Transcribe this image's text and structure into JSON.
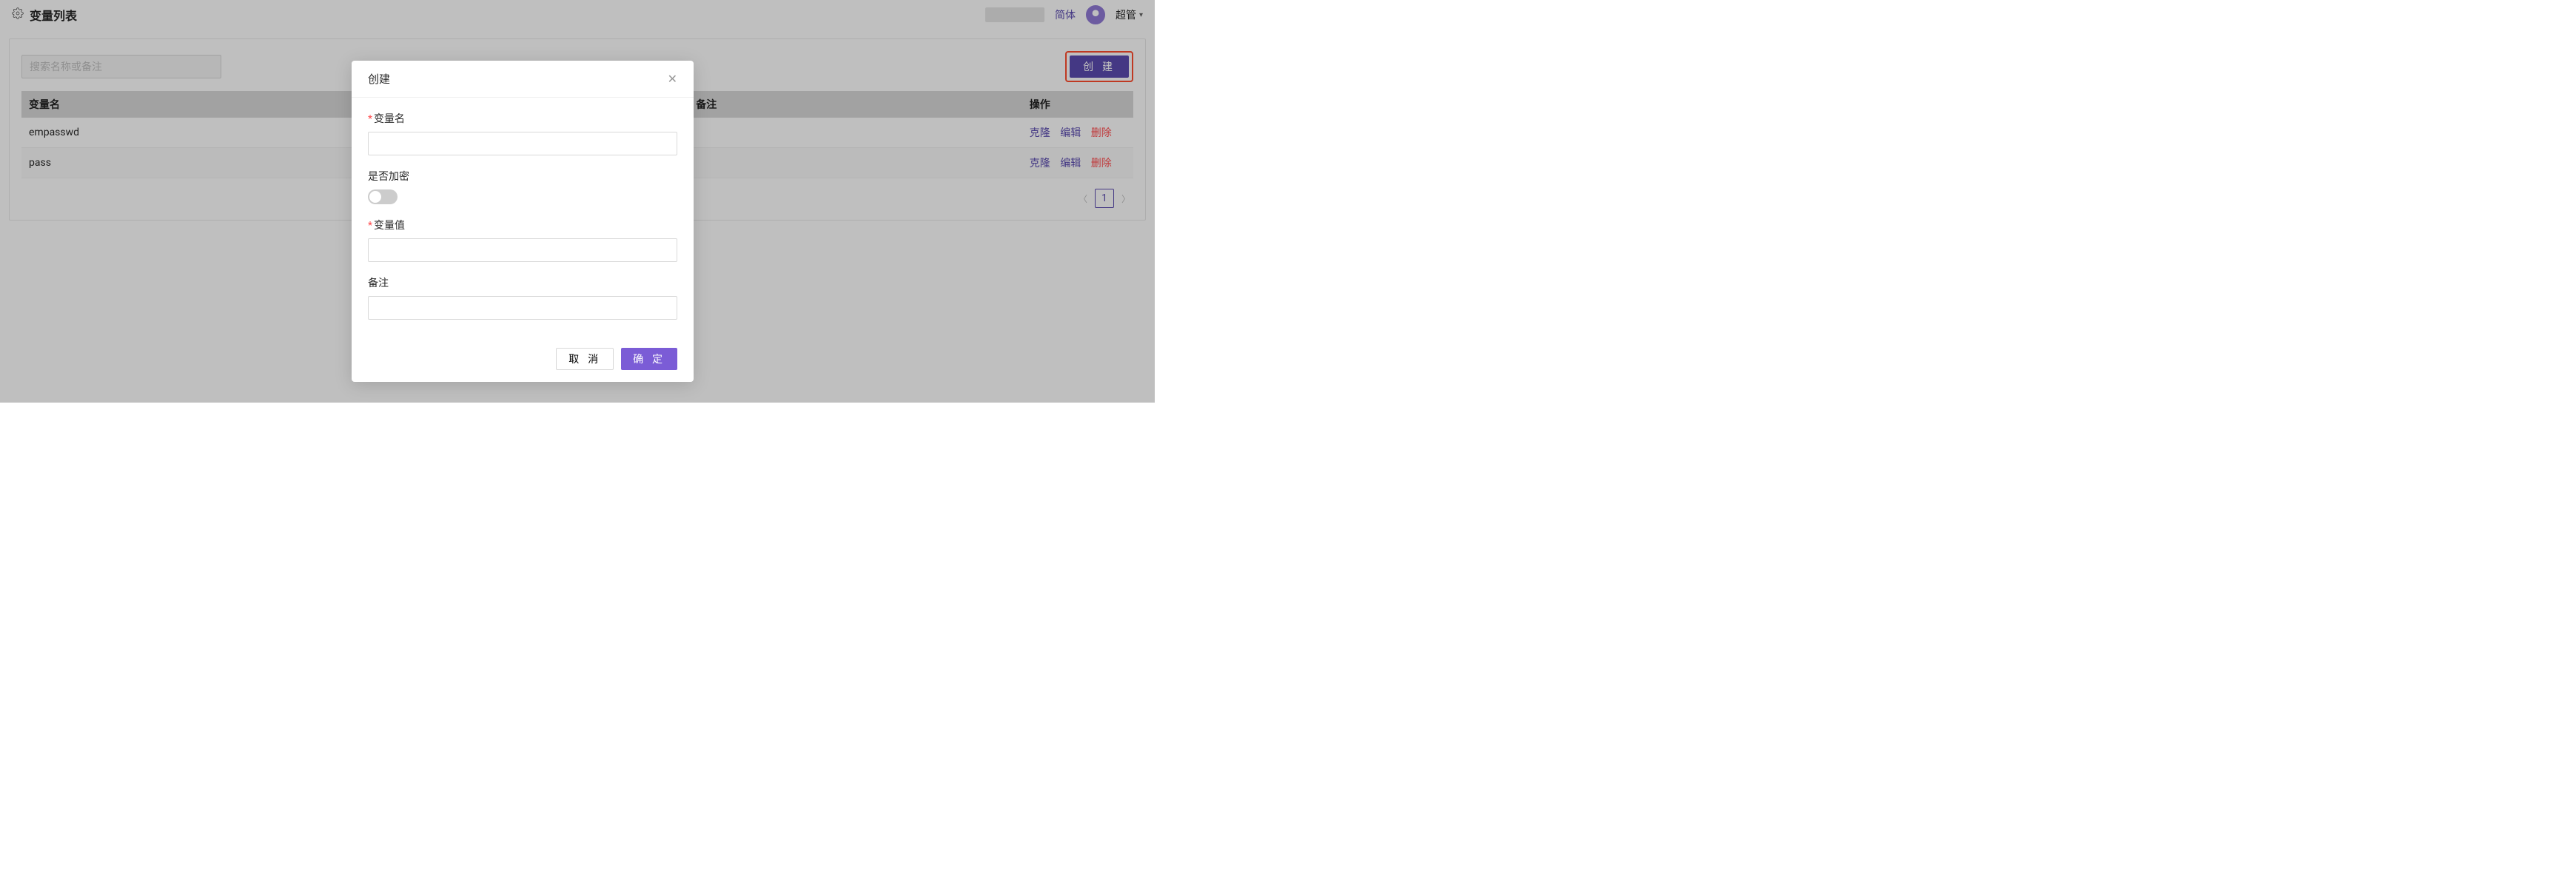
{
  "header": {
    "title": "变量列表",
    "lang": "简体",
    "user": "超管"
  },
  "toolbar": {
    "search_placeholder": "搜索名称或备注",
    "create_label": "创 建"
  },
  "table": {
    "columns": {
      "name": "变量名",
      "remark": "备注",
      "actions": "操作"
    },
    "action_labels": {
      "clone": "克隆",
      "edit": "编辑",
      "delete": "删除"
    },
    "rows": [
      {
        "name": "empasswd",
        "remark": ""
      },
      {
        "name": "pass",
        "remark": ""
      }
    ]
  },
  "pagination": {
    "current": "1"
  },
  "modal": {
    "title": "创建",
    "fields": {
      "var_name": "变量名",
      "encrypt": "是否加密",
      "var_value": "变量值",
      "remark": "备注"
    },
    "cancel": "取 消",
    "confirm": "确 定"
  }
}
